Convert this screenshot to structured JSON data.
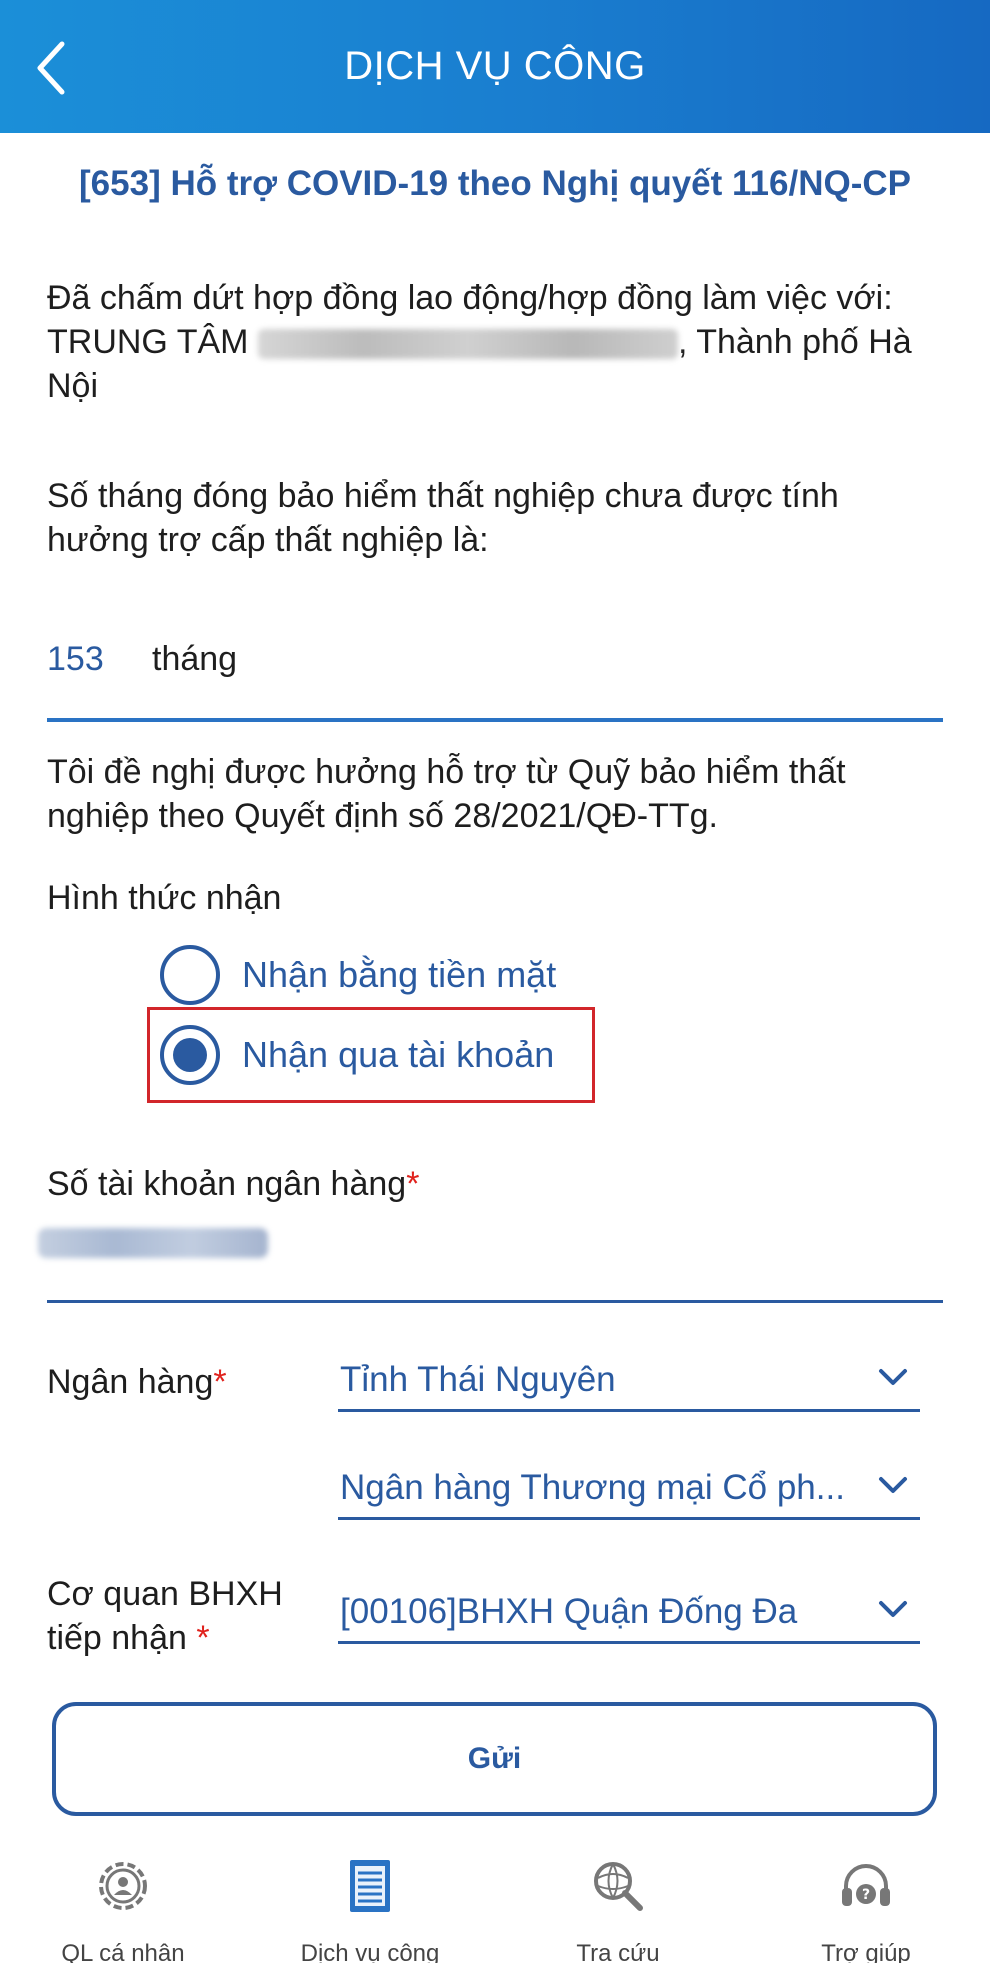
{
  "header": {
    "title": "DỊCH VỤ CÔNG",
    "back_icon": "chevron-left-icon"
  },
  "form": {
    "title": "[653] Hỗ trợ COVID-19 theo Nghị quyết 116/NQ-CP",
    "terminated_prefix": "Đã chấm dứt hợp đồng  lao động/hợp đồng làm việc với: TRUNG TÂM",
    "terminated_suffix": ", Thành phố Hà Nội",
    "months_question": "Số tháng đóng bảo hiểm thất nghiệp chưa được tính hưởng trợ cấp thất nghiệp là:",
    "months_value": "153",
    "months_unit": "tháng",
    "request_text": "Tôi đề nghị được hưởng hỗ trợ từ Quỹ bảo hiểm thất nghiệp theo Quyết định số 28/2021/QĐ-TTg.",
    "receive_label": "Hình thức nhận",
    "receive_options": [
      {
        "label": "Nhận bằng tiền mặt",
        "selected": false
      },
      {
        "label": "Nhận qua tài khoản",
        "selected": true
      }
    ],
    "account_label": "Số tài khoản ngân hàng",
    "bank_label": "Ngân hàng",
    "bank_province": "Tỉnh Thái Nguyên",
    "bank_name": "Ngân hàng Thương mại Cổ ph...",
    "agency_label_line1": "Cơ quan BHXH",
    "agency_label_line2": "tiếp nhận",
    "agency_value": "[00106]BHXH Quận Đống Đa",
    "required_mark": "*",
    "submit_label": "Gửi"
  },
  "nav": {
    "items": [
      {
        "label": "QL cá nhân",
        "icon": "user-gear-icon"
      },
      {
        "label": "Dịch vụ công",
        "icon": "document-icon"
      },
      {
        "label": "Tra cứu",
        "icon": "globe-search-icon"
      },
      {
        "label": "Trợ giúp",
        "icon": "headset-help-icon"
      }
    ]
  },
  "colors": {
    "header": "#1a7fd0",
    "primary": "#2a5aa0",
    "required": "#e0221d",
    "highlight": "#d2262a"
  }
}
